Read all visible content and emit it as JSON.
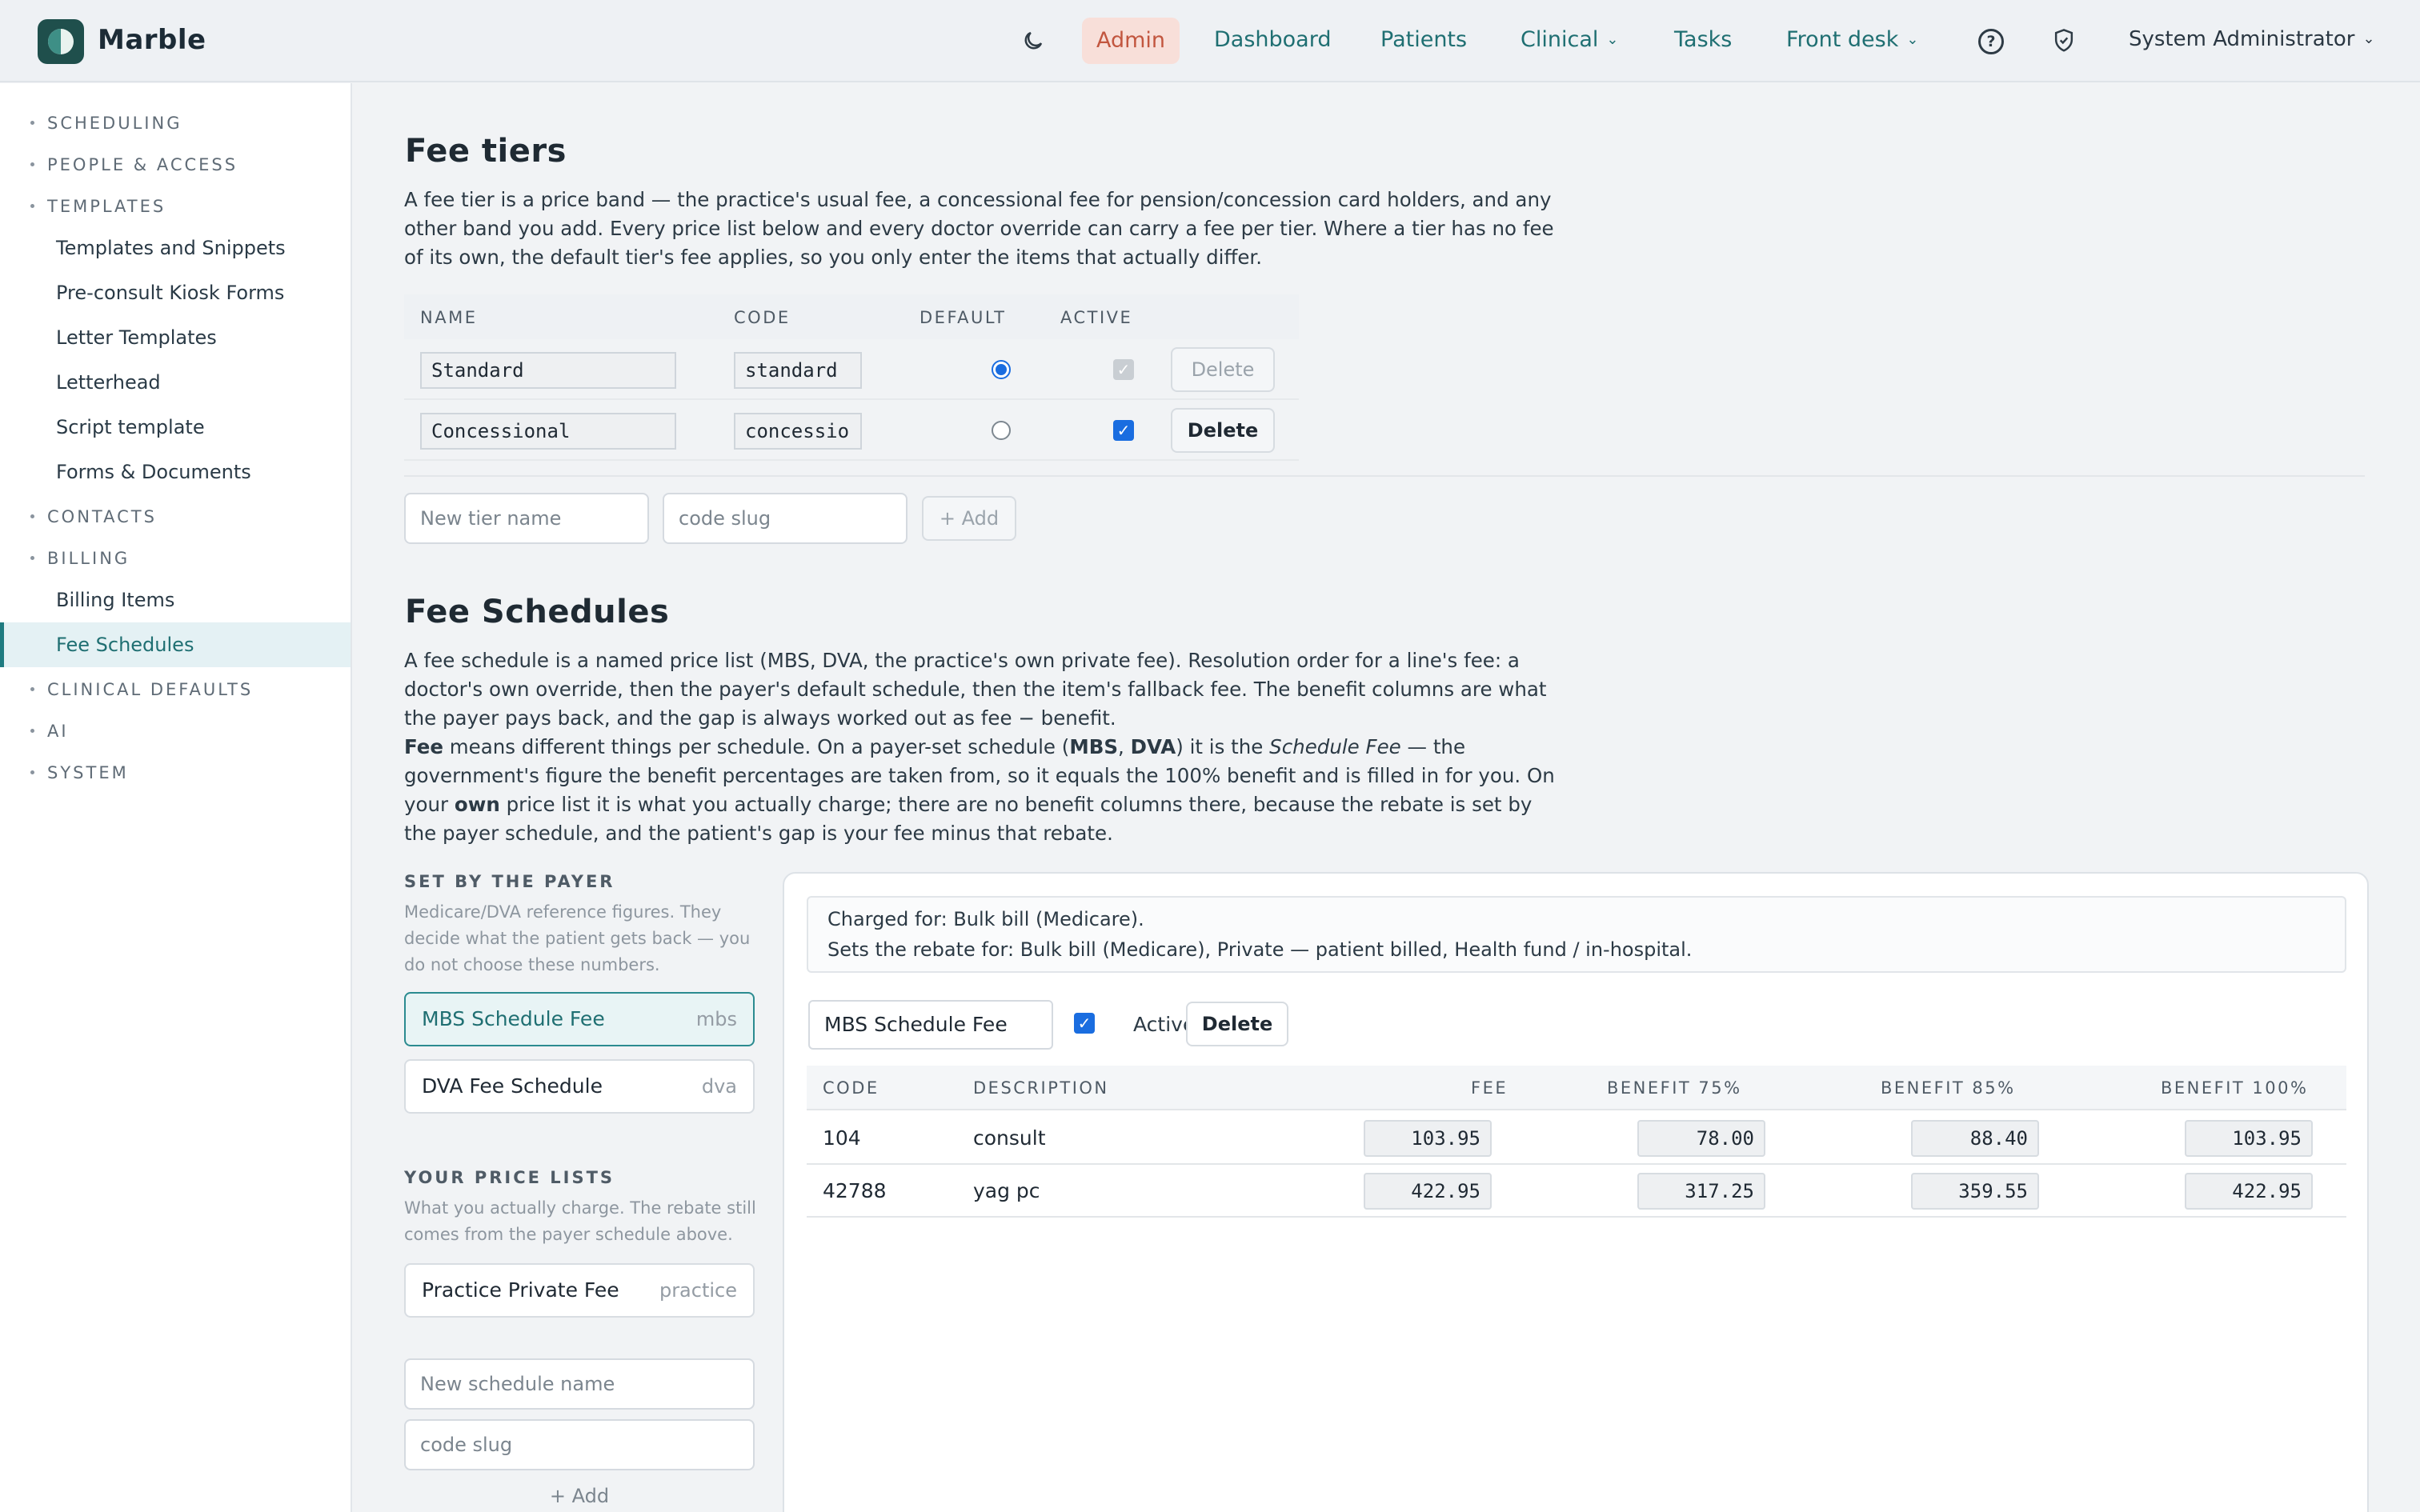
{
  "app": {
    "name": "Marble"
  },
  "nav": {
    "admin": "Admin",
    "dashboard": "Dashboard",
    "patients": "Patients",
    "clinical": "Clinical",
    "tasks": "Tasks",
    "front_desk": "Front desk",
    "user": "System Administrator"
  },
  "sidebar": {
    "groups": [
      "SCHEDULING",
      "PEOPLE & ACCESS",
      "TEMPLATES",
      "CONTACTS",
      "BILLING",
      "CLINICAL DEFAULTS",
      "AI",
      "SYSTEM"
    ],
    "template_items": [
      "Templates and Snippets",
      "Pre-consult Kiosk Forms",
      "Letter Templates",
      "Letterhead",
      "Script template",
      "Forms & Documents"
    ],
    "billing_items": [
      "Billing Items",
      "Fee Schedules"
    ],
    "active": "Fee Schedules"
  },
  "fee_tiers": {
    "title": "Fee tiers",
    "description": "A fee tier is a price band — the practice's usual fee, a concessional fee for pension/concession card holders, and any other band you add. Every price list below and every doctor override can carry a fee per tier. Where a tier has no fee of its own, the default tier's fee applies, so you only enter the items that actually differ.",
    "columns": [
      "NAME",
      "CODE",
      "DEFAULT",
      "ACTIVE"
    ],
    "rows": [
      {
        "name": "Standard",
        "code": "standard",
        "default": true,
        "active": true,
        "active_disabled": true,
        "delete_label": "Delete",
        "delete_disabled": true
      },
      {
        "name": "Concessional",
        "code": "concessio",
        "default": false,
        "active": true,
        "active_disabled": false,
        "delete_label": "Delete",
        "delete_disabled": false
      }
    ],
    "new_name_placeholder": "New tier name",
    "new_code_placeholder": "code slug",
    "add_label": "+ Add"
  },
  "fee_schedules": {
    "title": "Fee Schedules",
    "description_1": "A fee schedule is a named price list (MBS, DVA, the practice's own private fee). Resolution order for a line's fee: a doctor's own override, then the payer's default schedule, then the item's fallback fee. The benefit columns are what the payer pays back, and the gap is always worked out as fee − benefit.",
    "description_2_fee": "Fee",
    "description_2_a": " means different things per schedule. On a payer-set schedule (",
    "description_2_mbs": "MBS",
    "description_2_comma": ", ",
    "description_2_dva": "DVA",
    "description_2_b": ") it is the ",
    "description_2_sf": "Schedule Fee",
    "description_2_c": " — the government's figure the benefit percentages are taken from, so it equals the 100% benefit and is filled in for you. On your ",
    "description_2_own": "own",
    "description_2_d": " price list it is what you actually charge; there are no benefit columns there, because the rebate is set by the payer schedule, and the patient's gap is your fee minus that rebate.",
    "payer_label": "SET BY THE PAYER",
    "payer_note": "Medicare/DVA reference figures. They decide what the patient gets back — you do not choose these numbers.",
    "payer_schedules": [
      {
        "name": "MBS Schedule Fee",
        "slug": "mbs"
      },
      {
        "name": "DVA Fee Schedule",
        "slug": "dva"
      }
    ],
    "own_label": "YOUR PRICE LISTS",
    "own_note": "What you actually charge. The rebate still comes from the payer schedule above.",
    "own_schedules": [
      {
        "name": "Practice Private Fee",
        "slug": "practice"
      }
    ],
    "new_name_placeholder": "New schedule name",
    "new_code_placeholder": "code slug",
    "add_label": "+ Add",
    "detail": {
      "charged_for": "Charged for: Bulk bill (Medicare).",
      "sets_rebate": "Sets the rebate for: Bulk bill (Medicare), Private — patient billed, Health fund / in-hospital.",
      "name": "MBS Schedule Fee",
      "active_label": "Active",
      "delete_label": "Delete",
      "columns": [
        "CODE",
        "DESCRIPTION",
        "FEE",
        "BENEFIT 75%",
        "BENEFIT 85%",
        "BENEFIT 100%"
      ],
      "rows": [
        {
          "code": "104",
          "description": "consult",
          "fee": "103.95",
          "b75": "78.00",
          "b85": "88.40",
          "b100": "103.95"
        },
        {
          "code": "42788",
          "description": "yag pc",
          "fee": "422.95",
          "b75": "317.25",
          "b85": "359.55",
          "b100": "422.95"
        }
      ]
    }
  }
}
